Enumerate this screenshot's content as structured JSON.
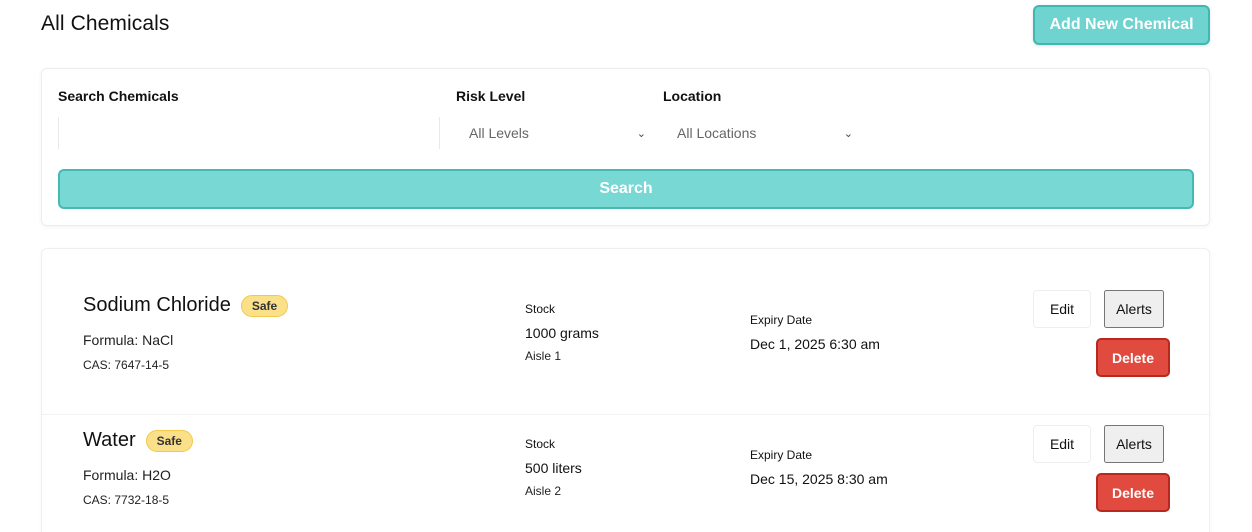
{
  "header": {
    "title": "All Chemicals",
    "add_button": "Add New Chemical"
  },
  "filters": {
    "search_label": "Search Chemicals",
    "search_value": "",
    "risk_label": "Risk Level",
    "risk_selected": "All Levels",
    "location_label": "Location",
    "location_selected": "All Locations",
    "search_button": "Search"
  },
  "colors": {
    "accent": "#6fd3cf",
    "accent_border": "#41b7b2",
    "danger": "#e04a3f",
    "safe_badge": "#fbe08a"
  },
  "chemicals": [
    {
      "name": "Sodium Chloride",
      "risk": "Safe",
      "formula": "Formula: NaCl",
      "cas": "CAS: 7647-14-5",
      "stock_label": "Stock",
      "stock": "1000 grams",
      "location": "Aisle 1",
      "expiry_label": "Expiry Date",
      "expiry": "Dec 1, 2025 6:30 am",
      "edit_label": "Edit",
      "alerts_label": "Alerts",
      "delete_label": "Delete"
    },
    {
      "name": "Water",
      "risk": "Safe",
      "formula": "Formula: H2O",
      "cas": "CAS: 7732-18-5",
      "stock_label": "Stock",
      "stock": "500 liters",
      "location": "Aisle 2",
      "expiry_label": "Expiry Date",
      "expiry": "Dec 15, 2025 8:30 am",
      "edit_label": "Edit",
      "alerts_label": "Alerts",
      "delete_label": "Delete"
    }
  ]
}
